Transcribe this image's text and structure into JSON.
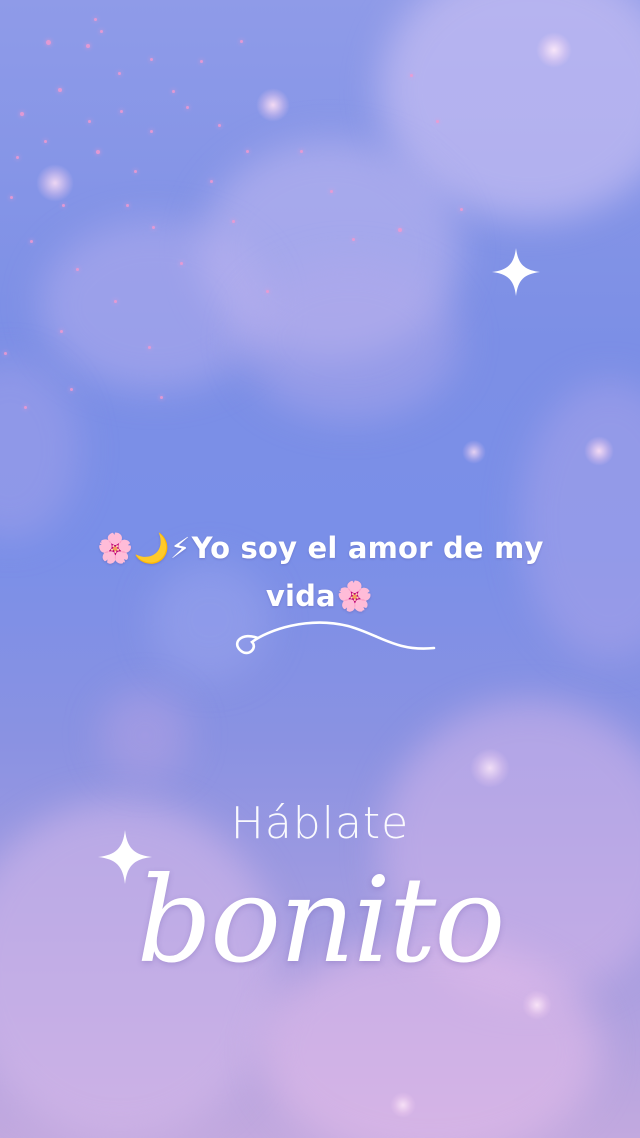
{
  "caption": {
    "prefix_emojis": "🌸🌙⚡",
    "line1": "Yo soy el amor de my",
    "line2": "vida",
    "suffix_emoji": "🌸"
  },
  "title": {
    "top": "Háblate",
    "script": "bonito"
  },
  "colors": {
    "sky_top": "#8f9be8",
    "sky_mid": "#7a8fe8",
    "sky_bottom": "#c2a9df",
    "glitter": "#f19ad0",
    "text": "#ffffff"
  },
  "icons": {
    "sparkle_star": "four-point-star",
    "swirl_ornament": "swirl-divider"
  }
}
